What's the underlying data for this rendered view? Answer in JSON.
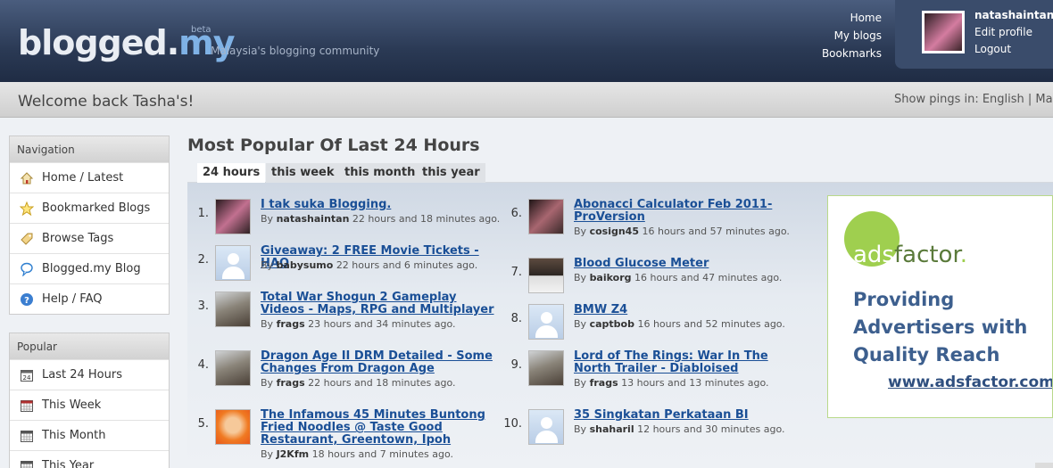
{
  "header": {
    "logo_part1": "blogged.",
    "logo_part2": "my",
    "beta": "beta",
    "tagline": "Malaysia's blogging community",
    "nav": [
      "Home",
      "My blogs",
      "Bookmarks"
    ],
    "user": {
      "name": "natashaintan",
      "links": [
        "Edit profile",
        "Logout"
      ]
    }
  },
  "welcome": {
    "text": "Welcome back Tasha's!",
    "pings": "Show pings in: English | Mala"
  },
  "sidebar": {
    "navigation": {
      "title": "Navigation",
      "items": [
        {
          "label": "Home / Latest",
          "icon": "home-icon"
        },
        {
          "label": "Bookmarked Blogs",
          "icon": "star-icon"
        },
        {
          "label": "Browse Tags",
          "icon": "tag-icon"
        },
        {
          "label": "Blogged.my Blog",
          "icon": "speech-bubble-icon"
        },
        {
          "label": "Help / FAQ",
          "icon": "help-icon"
        }
      ]
    },
    "popular": {
      "title": "Popular",
      "items": [
        {
          "label": "Last 24 Hours",
          "icon": "calendar-24-icon"
        },
        {
          "label": "This Week",
          "icon": "calendar-week-icon"
        },
        {
          "label": "This Month",
          "icon": "calendar-month-icon"
        },
        {
          "label": "This Year",
          "icon": "calendar-year-icon"
        }
      ]
    }
  },
  "main": {
    "title": "Most Popular Of Last 24 Hours",
    "tabs": [
      "24 hours",
      "this week",
      "this month",
      "this year"
    ],
    "active_tab": "24 hours",
    "entries": [
      {
        "num": "1.",
        "title": "I tak suka Blogging.",
        "by_label": "By",
        "author": "natashaintan",
        "time": "22 hours and 18 minutes ago."
      },
      {
        "num": "2.",
        "title": "Giveaway: 2 FREE Movie Tickets - HAQ",
        "by_label": "By",
        "author": "babysumo",
        "time": "22 hours and 6 minutes ago."
      },
      {
        "num": "3.",
        "title": "Total War Shogun 2 Gameplay Videos - Maps, RPG and Multiplayer",
        "by_label": "By",
        "author": "frags",
        "time": "23 hours and 34 minutes ago."
      },
      {
        "num": "4.",
        "title": "Dragon Age II DRM Detailed - Some Changes From Dragon Age",
        "by_label": "By",
        "author": "frags",
        "time": "22 hours and 18 minutes ago."
      },
      {
        "num": "5.",
        "title": "The Infamous 45 Minutes Buntong Fried Noodles @ Taste Good Restaurant, Greentown, Ipoh",
        "by_label": "By",
        "author": "J2Kfm",
        "time": "18 hours and 7 minutes ago."
      },
      {
        "num": "6.",
        "title": "Abonacci Calculator Feb 2011- ProVersion",
        "by_label": "By",
        "author": "cosign45",
        "time": "16 hours and 57 minutes ago."
      },
      {
        "num": "7.",
        "title": "Blood Glucose Meter",
        "by_label": "By",
        "author": "baikorg",
        "time": "16 hours and 47 minutes ago."
      },
      {
        "num": "8.",
        "title": "BMW Z4",
        "by_label": "By",
        "author": "captbob",
        "time": "16 hours and 52 minutes ago."
      },
      {
        "num": "9.",
        "title": "Lord of The Rings: War In The North Trailer - Diabloised",
        "by_label": "By",
        "author": "frags",
        "time": "13 hours and 13 minutes ago."
      },
      {
        "num": "10.",
        "title": "35 Singkatan Perkataan BI",
        "by_label": "By",
        "author": "shaharil",
        "time": "12 hours and 30 minutes ago."
      }
    ]
  },
  "ad": {
    "brand_prefix": "ads",
    "brand_suffix": "factor",
    "brand_dot": ".",
    "slogan": "Providing Advertisers with Quality Reach",
    "url": "www.adsfactor.com"
  }
}
